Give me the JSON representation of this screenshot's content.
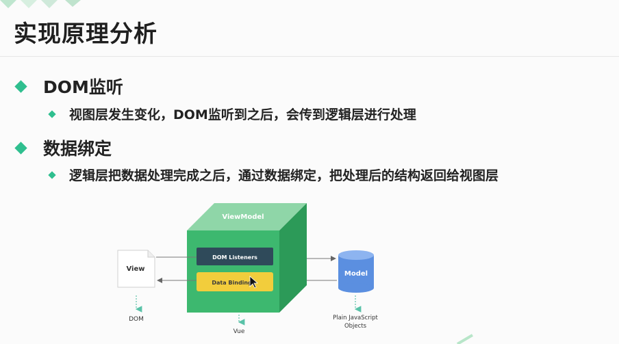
{
  "slide": {
    "title": "实现原理分析",
    "bullets": [
      {
        "heading": "DOM监听",
        "sub": "视图层发生变化，DOM监听到之后，会传到逻辑层进行处理"
      },
      {
        "heading": "数据绑定",
        "sub": "逻辑层把数据处理完成之后，通过数据绑定，把处理后的结构返回给视图层"
      }
    ]
  },
  "diagram": {
    "viewmodel_label": "ViewModel",
    "dom_listeners_label": "DOM Listeners",
    "data_bindings_label": "Data Bindings",
    "view_label": "View",
    "model_label": "Model",
    "dom_caption": "DOM",
    "vue_caption": "Vue",
    "pjo_caption_line1": "Plain JavaScript",
    "pjo_caption_line2": "Objects"
  },
  "colors": {
    "accent": "#2fbf8f",
    "cube_front": "#3db86f",
    "cube_top": "#8fd6a8",
    "cube_side": "#2c9a58",
    "dom_listeners_box": "#2f4a5a",
    "data_bindings_box": "#f2cd3c",
    "model_cylinder": "#5b8fe0"
  }
}
